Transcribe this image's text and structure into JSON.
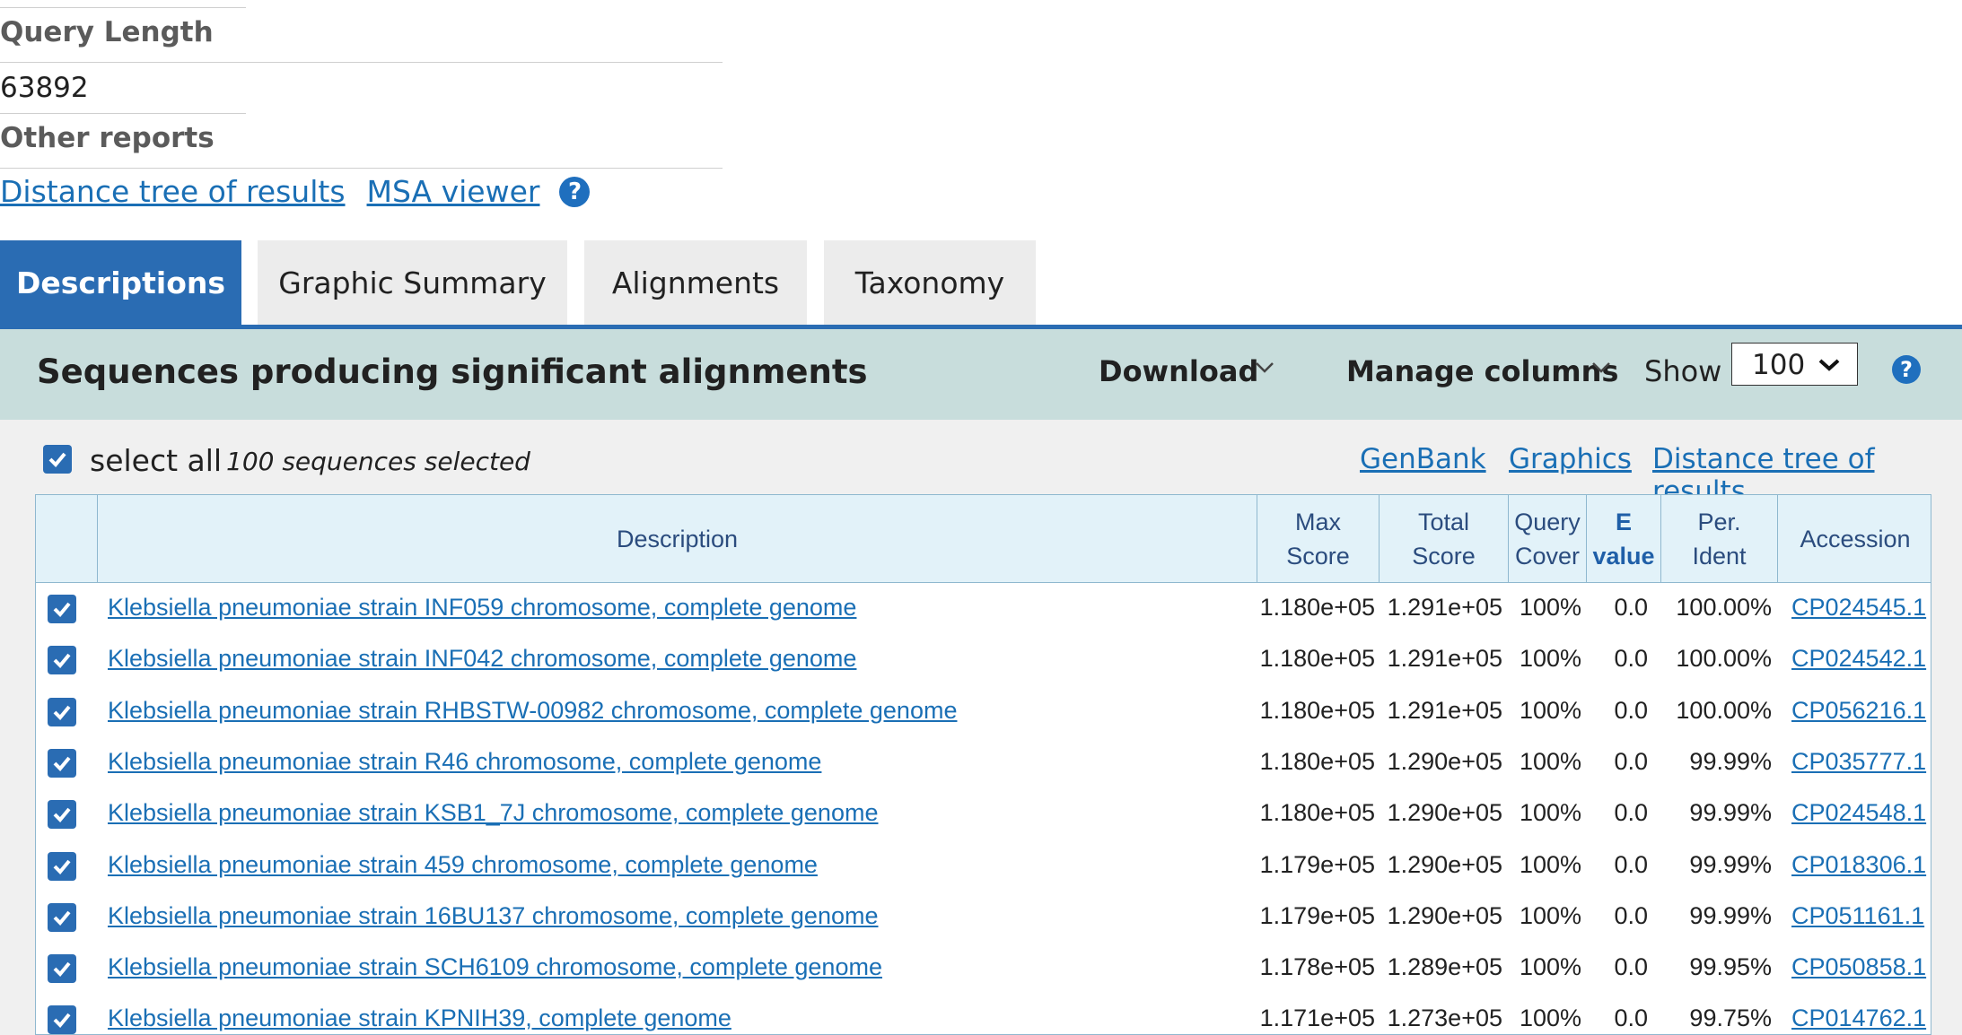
{
  "info": {
    "query_length_label": "Query Length",
    "query_length_value": "63892",
    "other_reports_label": "Other reports",
    "links": [
      "Distance tree of results",
      "MSA viewer"
    ],
    "help_icon": "question-circle-icon"
  },
  "tabs": [
    {
      "label": "Descriptions",
      "active": true
    },
    {
      "label": "Graphic Summary",
      "active": false
    },
    {
      "label": "Alignments",
      "active": false
    },
    {
      "label": "Taxonomy",
      "active": false
    }
  ],
  "header": {
    "title": "Sequences producing significant alignments",
    "download": "Download",
    "manage_columns": "Manage columns",
    "show_label": "Show",
    "show_value": "100"
  },
  "selection": {
    "select_all": "select all",
    "count": "100 sequences selected",
    "links": [
      "GenBank",
      "Graphics",
      "Distance tree of results"
    ]
  },
  "table": {
    "columns": {
      "description": "Description",
      "max_score": [
        "Max",
        "Score"
      ],
      "total_score": [
        "Total",
        "Score"
      ],
      "query_cover": [
        "Query",
        "Cover"
      ],
      "e_value": [
        "E",
        "value"
      ],
      "per_ident": [
        "Per.",
        "Ident"
      ],
      "accession": "Accession"
    },
    "rows": [
      {
        "description": "Klebsiella pneumoniae strain INF059 chromosome, complete genome",
        "max_score": "1.180e+05",
        "total_score": "1.291e+05",
        "query_cover": "100%",
        "e_value": "0.0",
        "per_ident": "100.00%",
        "accession": "CP024545.1"
      },
      {
        "description": "Klebsiella pneumoniae strain INF042 chromosome, complete genome",
        "max_score": "1.180e+05",
        "total_score": "1.291e+05",
        "query_cover": "100%",
        "e_value": "0.0",
        "per_ident": "100.00%",
        "accession": "CP024542.1"
      },
      {
        "description": "Klebsiella pneumoniae strain RHBSTW-00982 chromosome, complete genome",
        "max_score": "1.180e+05",
        "total_score": "1.291e+05",
        "query_cover": "100%",
        "e_value": "0.0",
        "per_ident": "100.00%",
        "accession": "CP056216.1"
      },
      {
        "description": "Klebsiella pneumoniae strain R46 chromosome, complete genome",
        "max_score": "1.180e+05",
        "total_score": "1.290e+05",
        "query_cover": "100%",
        "e_value": "0.0",
        "per_ident": "99.99%",
        "accession": "CP035777.1"
      },
      {
        "description": "Klebsiella pneumoniae strain KSB1_7J chromosome, complete genome",
        "max_score": "1.180e+05",
        "total_score": "1.290e+05",
        "query_cover": "100%",
        "e_value": "0.0",
        "per_ident": "99.99%",
        "accession": "CP024548.1"
      },
      {
        "description": "Klebsiella pneumoniae strain 459 chromosome, complete genome",
        "max_score": "1.179e+05",
        "total_score": "1.290e+05",
        "query_cover": "100%",
        "e_value": "0.0",
        "per_ident": "99.99%",
        "accession": "CP018306.1"
      },
      {
        "description": "Klebsiella pneumoniae strain 16BU137 chromosome, complete genome",
        "max_score": "1.179e+05",
        "total_score": "1.290e+05",
        "query_cover": "100%",
        "e_value": "0.0",
        "per_ident": "99.99%",
        "accession": "CP051161.1"
      },
      {
        "description": "Klebsiella pneumoniae strain SCH6109 chromosome, complete genome",
        "max_score": "1.178e+05",
        "total_score": "1.289e+05",
        "query_cover": "100%",
        "e_value": "0.0",
        "per_ident": "99.95%",
        "accession": "CP050858.1"
      },
      {
        "description": "Klebsiella pneumoniae strain KPNIH39, complete genome",
        "max_score": "1.171e+05",
        "total_score": "1.273e+05",
        "query_cover": "100%",
        "e_value": "0.0",
        "per_ident": "99.75%",
        "accession": "CP014762.1"
      }
    ]
  },
  "colors": {
    "accent": "#2a6cb3",
    "link": "#1a6fb5",
    "header_bar": "#c8dddc",
    "table_header": "#e2f2f9"
  }
}
